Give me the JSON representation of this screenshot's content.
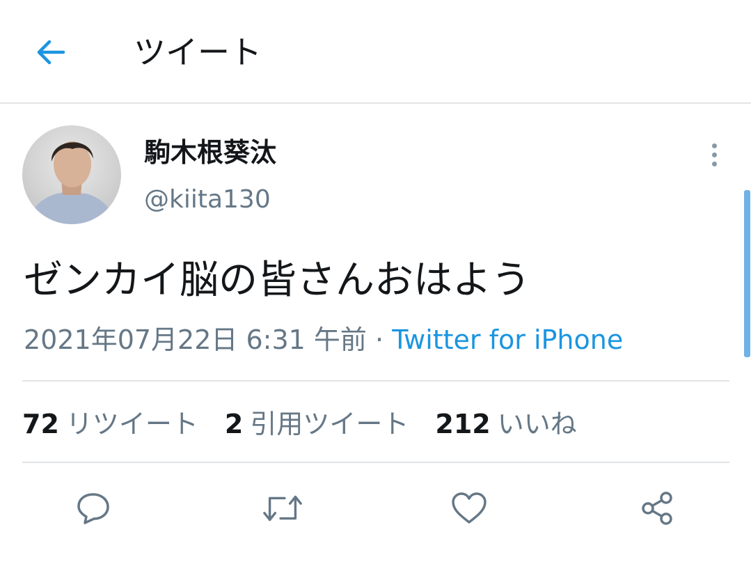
{
  "header": {
    "title": "ツイート",
    "back_icon": "arrow-left-icon"
  },
  "tweet": {
    "display_name": "駒木根葵汰",
    "handle": "@kiita130",
    "text": "ゼンカイ脳の皆さんおはよう",
    "date": "2021年07月22日 6:31 午前",
    "separator": "·",
    "source": "Twitter for iPhone"
  },
  "stats": {
    "retweets_count": "72",
    "retweets_label": "リツイート",
    "quotes_count": "2",
    "quotes_label": "引用ツイート",
    "likes_count": "212",
    "likes_label": "いいね"
  },
  "actions": [
    "reply-icon",
    "retweet-icon",
    "like-icon",
    "share-icon"
  ],
  "colors": {
    "accent": "#1b95e0",
    "text": "#14171a",
    "secondary": "#657786",
    "divider": "#e1e4e6"
  }
}
